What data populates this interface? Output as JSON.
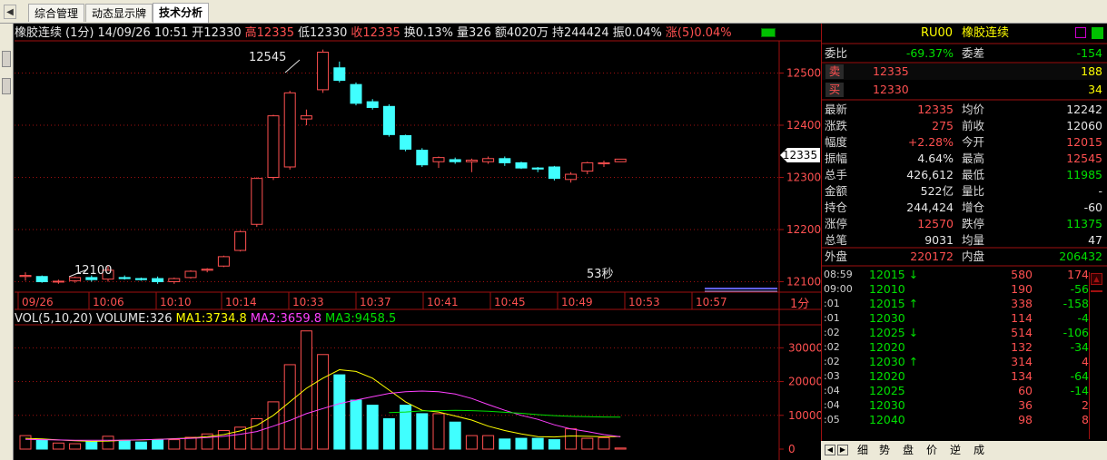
{
  "tabs": {
    "nav_left": "◀",
    "items": [
      "综合管理",
      "动态显示牌",
      "技术分析"
    ],
    "active": 2
  },
  "info_bar": {
    "name": "橡胶连续",
    "period": "(1分)",
    "date": "14/09/26",
    "time": "10:51",
    "open": "开12330",
    "high": "高12335",
    "low": "低12330",
    "close": "收12335",
    "turnover": "换0.13%",
    "vol": "量326",
    "amount": "额4020万",
    "hold": "持244424",
    "amp": "振0.04%",
    "chg": "涨(5)0.04%"
  },
  "price_axis": {
    "labels": [
      "12500",
      "12400",
      "12300",
      "12200",
      "12100"
    ],
    "current": "12335"
  },
  "time_axis": {
    "labels": [
      "09/26",
      "10:06",
      "10:10",
      "10:14",
      "10:33",
      "10:37",
      "10:41",
      "10:45",
      "10:49",
      "10:53",
      "10:57"
    ],
    "period": "1分"
  },
  "chart_annotations": {
    "high": "12545",
    "low": "12100",
    "countdown": "53秒"
  },
  "vol_bar": {
    "label": "VOL(5,10,20)",
    "volume": "VOLUME:326",
    "ma1": "MA1:3734.8",
    "ma2": "MA2:3659.8",
    "ma3": "MA3:9458.5"
  },
  "vol_axis": {
    "labels": [
      "30000",
      "20000",
      "10000",
      "0"
    ]
  },
  "colors": {
    "up": "#ff5050",
    "down": "#40ffff",
    "ma1": "#ffff00",
    "ma2": "#ff40ff",
    "ma3": "#00e000",
    "grid": "#a01010"
  },
  "chart_data": {
    "type": "candlestick",
    "price_ylim": [
      12080,
      12560
    ],
    "candles": [
      {
        "o": 12110,
        "h": 12118,
        "l": 12102,
        "c": 12112
      },
      {
        "o": 12110,
        "h": 12112,
        "l": 12098,
        "c": 12100
      },
      {
        "o": 12100,
        "h": 12104,
        "l": 12096,
        "c": 12101
      },
      {
        "o": 12102,
        "h": 12110,
        "l": 12098,
        "c": 12108
      },
      {
        "o": 12108,
        "h": 12112,
        "l": 12100,
        "c": 12104
      },
      {
        "o": 12105,
        "h": 12130,
        "l": 12100,
        "c": 12122
      },
      {
        "o": 12108,
        "h": 12112,
        "l": 12104,
        "c": 12106
      },
      {
        "o": 12106,
        "h": 12108,
        "l": 12102,
        "c": 12104
      },
      {
        "o": 12106,
        "h": 12110,
        "l": 12096,
        "c": 12100
      },
      {
        "o": 12100,
        "h": 12108,
        "l": 12096,
        "c": 12106
      },
      {
        "o": 12108,
        "h": 12122,
        "l": 12106,
        "c": 12120
      },
      {
        "o": 12122,
        "h": 12126,
        "l": 12118,
        "c": 12124
      },
      {
        "o": 12130,
        "h": 12150,
        "l": 12128,
        "c": 12148
      },
      {
        "o": 12160,
        "h": 12198,
        "l": 12158,
        "c": 12196
      },
      {
        "o": 12210,
        "h": 12300,
        "l": 12205,
        "c": 12298
      },
      {
        "o": 12300,
        "h": 12420,
        "l": 12295,
        "c": 12418
      },
      {
        "o": 12320,
        "h": 12466,
        "l": 12315,
        "c": 12462
      },
      {
        "o": 12412,
        "h": 12430,
        "l": 12400,
        "c": 12418
      },
      {
        "o": 12468,
        "h": 12545,
        "l": 12462,
        "c": 12540
      },
      {
        "o": 12510,
        "h": 12522,
        "l": 12482,
        "c": 12486
      },
      {
        "o": 12478,
        "h": 12482,
        "l": 12438,
        "c": 12442
      },
      {
        "o": 12445,
        "h": 12450,
        "l": 12430,
        "c": 12434
      },
      {
        "o": 12436,
        "h": 12440,
        "l": 12378,
        "c": 12382
      },
      {
        "o": 12380,
        "h": 12382,
        "l": 12350,
        "c": 12354
      },
      {
        "o": 12352,
        "h": 12356,
        "l": 12320,
        "c": 12324
      },
      {
        "o": 12330,
        "h": 12340,
        "l": 12318,
        "c": 12338
      },
      {
        "o": 12334,
        "h": 12338,
        "l": 12326,
        "c": 12330
      },
      {
        "o": 12330,
        "h": 12336,
        "l": 12310,
        "c": 12333
      },
      {
        "o": 12330,
        "h": 12340,
        "l": 12326,
        "c": 12336
      },
      {
        "o": 12336,
        "h": 12340,
        "l": 12322,
        "c": 12328
      },
      {
        "o": 12328,
        "h": 12330,
        "l": 12316,
        "c": 12318
      },
      {
        "o": 12318,
        "h": 12320,
        "l": 12310,
        "c": 12316
      },
      {
        "o": 12320,
        "h": 12322,
        "l": 12294,
        "c": 12298
      },
      {
        "o": 12296,
        "h": 12310,
        "l": 12290,
        "c": 12306
      },
      {
        "o": 12312,
        "h": 12330,
        "l": 12306,
        "c": 12328
      },
      {
        "o": 12326,
        "h": 12332,
        "l": 12320,
        "c": 12328
      },
      {
        "o": 12330,
        "h": 12335,
        "l": 12330,
        "c": 12335
      }
    ],
    "vol_ylim": [
      0,
      36000
    ],
    "volumes": [
      4000,
      2800,
      1800,
      1600,
      2200,
      3800,
      2600,
      2100,
      2800,
      2800,
      3500,
      4500,
      5500,
      6500,
      9000,
      14000,
      25000,
      35000,
      28000,
      22000,
      14500,
      13000,
      9000,
      13000,
      10500,
      10500,
      8000,
      4000,
      4000,
      3000,
      3200,
      3200,
      2800,
      6000,
      3200,
      3400,
      326
    ],
    "ma1": [
      3200,
      3000,
      2700,
      2500,
      2300,
      2400,
      2600,
      2700,
      2900,
      3100,
      3300,
      3700,
      4300,
      5400,
      7000,
      10000,
      14000,
      18000,
      21000,
      23500,
      23000,
      21000,
      17500,
      14000,
      11500,
      11000,
      9800,
      8600,
      6800,
      5500,
      4500,
      3700,
      3600,
      3900,
      3800,
      3650,
      3734.8
    ],
    "ma2": [
      2900,
      2800,
      2700,
      2600,
      2600,
      2600,
      2650,
      2750,
      2900,
      3000,
      3200,
      3400,
      3800,
      4400,
      5200,
      6800,
      8500,
      10500,
      12000,
      13500,
      14500,
      15500,
      16500,
      17000,
      17200,
      17000,
      16300,
      15000,
      13200,
      11500,
      10000,
      8800,
      7200,
      6000,
      5200,
      4300,
      3659.8
    ],
    "ma3": [
      null,
      null,
      null,
      null,
      null,
      null,
      null,
      null,
      null,
      null,
      null,
      null,
      null,
      null,
      null,
      null,
      null,
      null,
      null,
      null,
      null,
      null,
      10800,
      11000,
      11300,
      11400,
      11500,
      11400,
      11200,
      10900,
      10600,
      10200,
      9900,
      9700,
      9600,
      9500,
      9458.5
    ]
  },
  "quote": {
    "symbol": "RU00",
    "name": "橡胶连续",
    "weibi": {
      "label": "委比",
      "value": "-69.37%"
    },
    "weicha": {
      "label": "委差",
      "value": "-154"
    },
    "sell": {
      "label": "卖",
      "price": "12335",
      "qty": "188"
    },
    "buy": {
      "label": "买",
      "price": "12330",
      "qty": "34"
    },
    "rows": [
      {
        "l1": "最新",
        "v1": "12335",
        "l2": "均价",
        "v2": "12242"
      },
      {
        "l1": "涨跌",
        "v1": "275",
        "l2": "前收",
        "v2": "12060"
      },
      {
        "l1": "幅度",
        "v1": "+2.28%",
        "l2": "今开",
        "v2": "12015"
      },
      {
        "l1": "振幅",
        "v1": "4.64%",
        "l2": "最高",
        "v2": "12545"
      },
      {
        "l1": "总手",
        "v1": "426,612",
        "l2": "最低",
        "v2": "11985"
      },
      {
        "l1": "金额",
        "v1": "522亿",
        "l2": "量比",
        "v2": "-"
      },
      {
        "l1": "持仓",
        "v1": "244,424",
        "l2": "增仓",
        "v2": "-60"
      },
      {
        "l1": "涨停",
        "v1": "12570",
        "l2": "跌停",
        "v2": "11375"
      },
      {
        "l1": "总笔",
        "v1": "9031",
        "l2": "均量",
        "v2": "47"
      }
    ],
    "waipan": {
      "label": "外盘",
      "value": "220172"
    },
    "neipan": {
      "label": "内盘",
      "value": "206432"
    }
  },
  "ticks": [
    {
      "t": "08:59",
      "p": "12015",
      "a": "↓",
      "q": "580",
      "d": "174"
    },
    {
      "t": "09:00",
      "p": "12010",
      "a": "",
      "q": "190",
      "d": "-56"
    },
    {
      "t": ":01",
      "p": "12015",
      "a": "↑",
      "q": "338",
      "d": "-158"
    },
    {
      "t": ":01",
      "p": "12030",
      "a": "",
      "q": "114",
      "d": "-4"
    },
    {
      "t": ":02",
      "p": "12025",
      "a": "↓",
      "q": "514",
      "d": "-106"
    },
    {
      "t": ":02",
      "p": "12020",
      "a": "",
      "q": "132",
      "d": "-34"
    },
    {
      "t": ":02",
      "p": "12030",
      "a": "↑",
      "q": "314",
      "d": "4"
    },
    {
      "t": ":03",
      "p": "12020",
      "a": "",
      "q": "134",
      "d": "-64"
    },
    {
      "t": ":04",
      "p": "12025",
      "a": "",
      "q": "60",
      "d": "-14"
    },
    {
      "t": ":04",
      "p": "12030",
      "a": "",
      "q": "36",
      "d": "2"
    },
    {
      "t": ":05",
      "p": "12040",
      "a": "",
      "q": "98",
      "d": "8"
    }
  ],
  "bottom_tabs": [
    "细",
    "势",
    "盘",
    "价",
    "逆",
    "成"
  ]
}
